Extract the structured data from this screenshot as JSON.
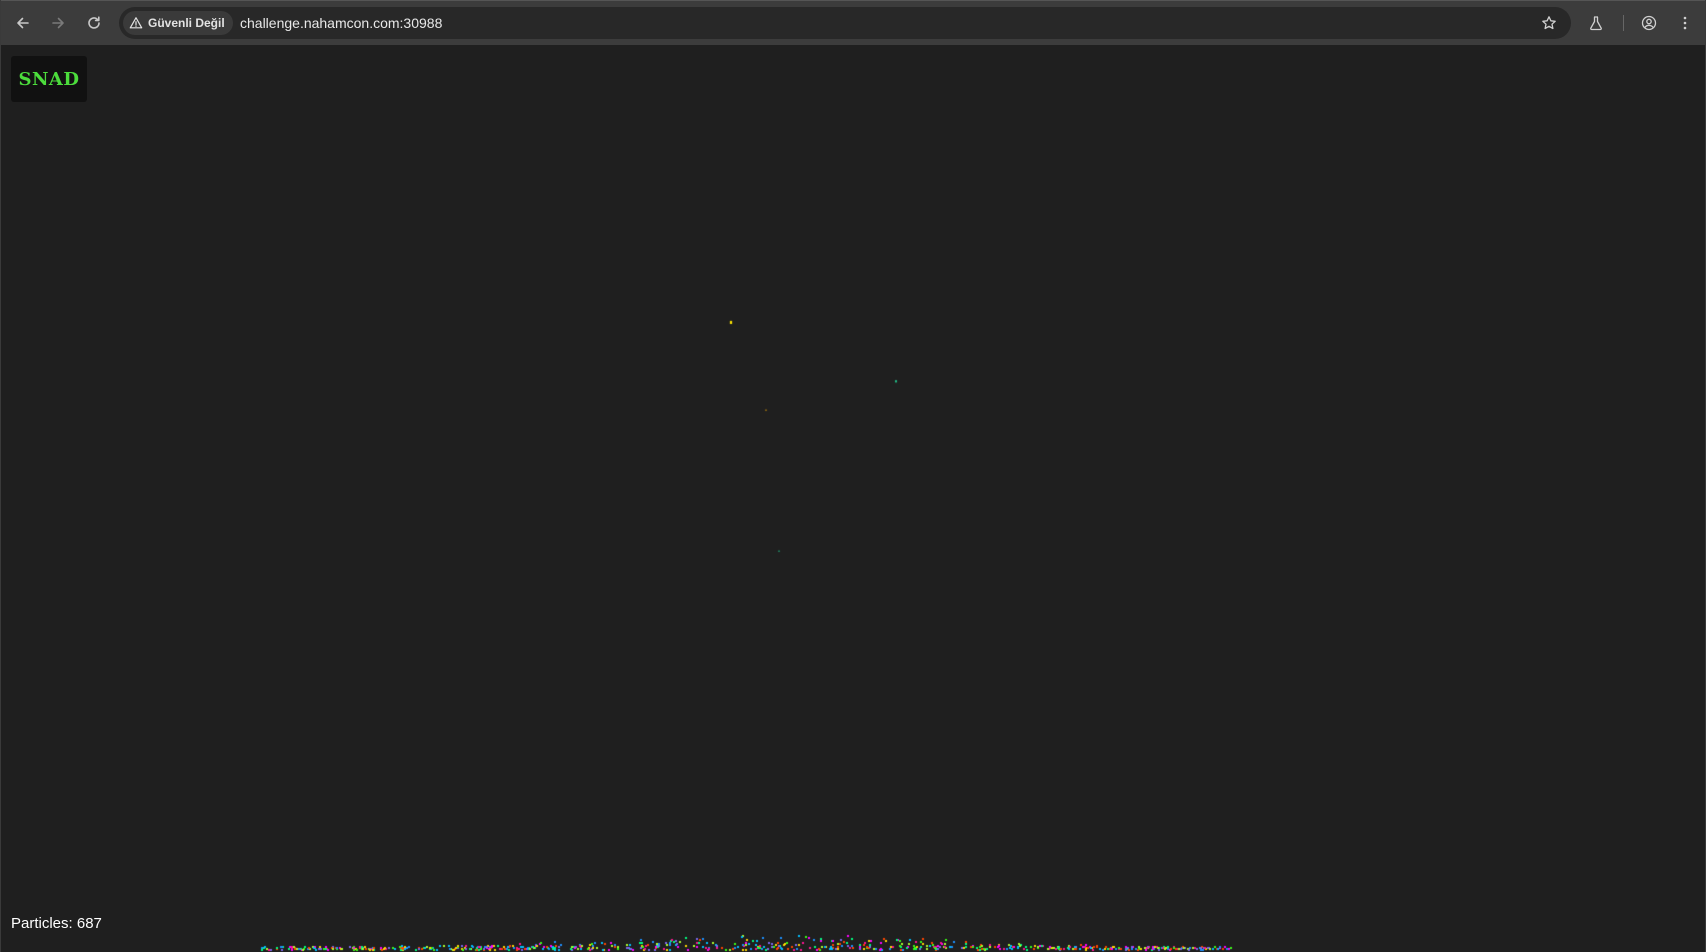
{
  "browser": {
    "security_label": "Güvenli Değil",
    "url": "challenge.nahamcon.com:30988"
  },
  "page": {
    "logo_text": "SNAD",
    "particles_label": "Particles: 687",
    "particle_count": 687
  },
  "colors": {
    "logo_text": "#4cdc3c",
    "background": "#1f1f1f",
    "particle_palette": [
      "#39ff14",
      "#ff1493",
      "#00bfff",
      "#ffd700",
      "#ff4500",
      "#7b68ee",
      "#00ff7f",
      "#ff00ff",
      "#adff2f",
      "#1e90ff"
    ]
  },
  "icons": {
    "back": "arrow-left-icon",
    "forward": "arrow-right-icon",
    "reload": "reload-icon",
    "warning": "warning-triangle-icon",
    "bookmark": "star-icon",
    "labs": "flask-icon",
    "profile": "profile-icon",
    "menu": "kebab-menu-icon"
  }
}
